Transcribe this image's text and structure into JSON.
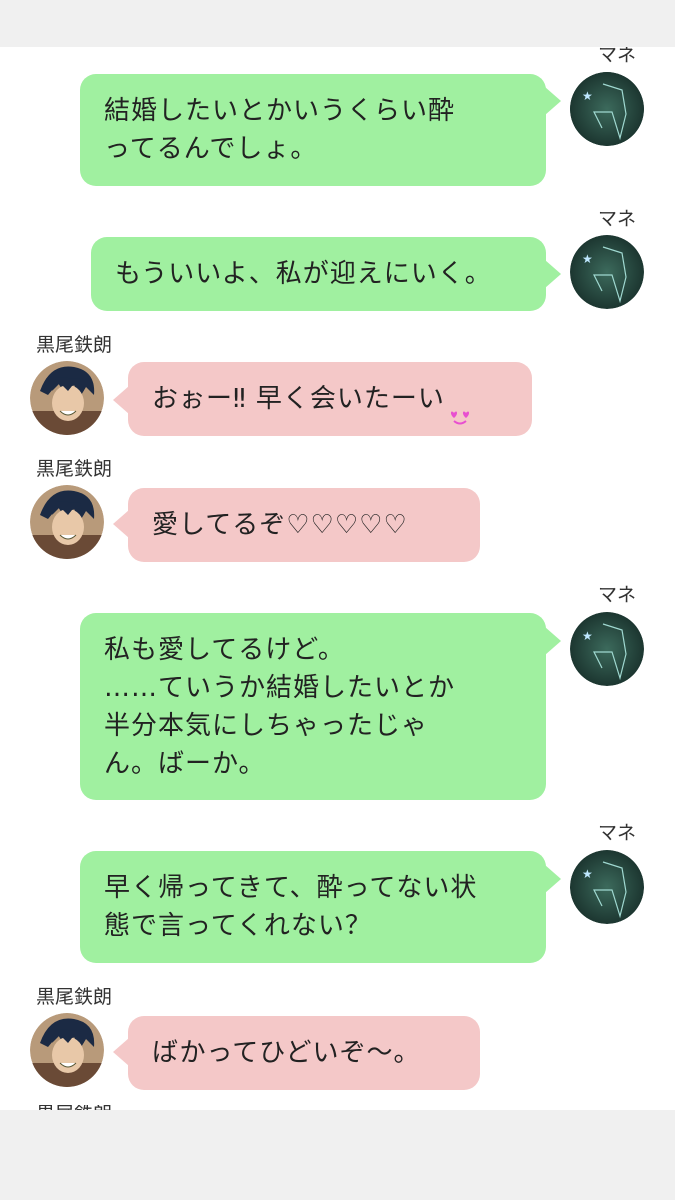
{
  "contacts": {
    "self_name": "マネ",
    "other_name": "黒尾鉄朗"
  },
  "messages": [
    {
      "side": "out",
      "name": "マネ",
      "text": "結婚したいとかいうくらい酔\nってるんでしょ。"
    },
    {
      "side": "out",
      "name": "マネ",
      "text": "もういいよ、私が迎えにいく。"
    },
    {
      "side": "in",
      "name": "黒尾鉄朗",
      "text": "おぉー‼ 早く会いたーい",
      "emoji": "heart-eyes"
    },
    {
      "side": "in",
      "name": "黒尾鉄朗",
      "text": "愛してるぞ♡♡♡♡♡"
    },
    {
      "side": "out",
      "name": "マネ",
      "text": "私も愛してるけど。\n……ていうか結婚したいとか\n半分本気にしちゃったじゃ\nん。ばーか。"
    },
    {
      "side": "out",
      "name": "マネ",
      "text": "早く帰ってきて、酔ってない状\n態で言ってくれない？"
    },
    {
      "side": "in",
      "name": "黒尾鉄朗",
      "text": "ばかってひどいぞ〜。"
    }
  ],
  "colors": {
    "outgoing_bubble": "#a0f0a0",
    "incoming_bubble": "#f4c8c8",
    "background": "#ffffff"
  }
}
